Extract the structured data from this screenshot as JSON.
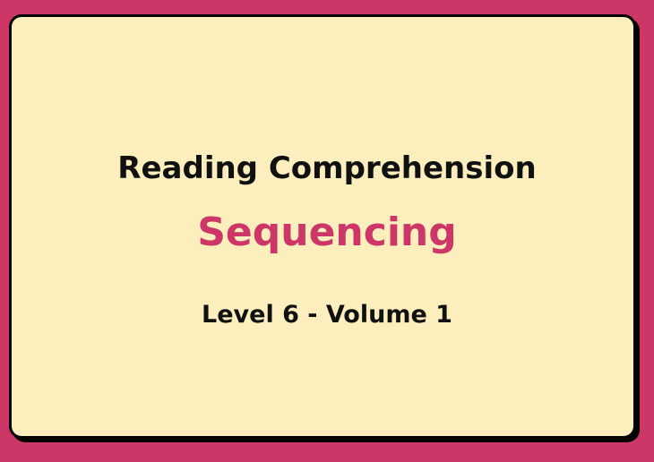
{
  "colors": {
    "background": "#cc3768",
    "card": "#fdeebd",
    "accent": "#cc3768"
  },
  "title": "Reading Comprehension",
  "subtitle": "Sequencing",
  "level": "Level 6 - Volume 1"
}
